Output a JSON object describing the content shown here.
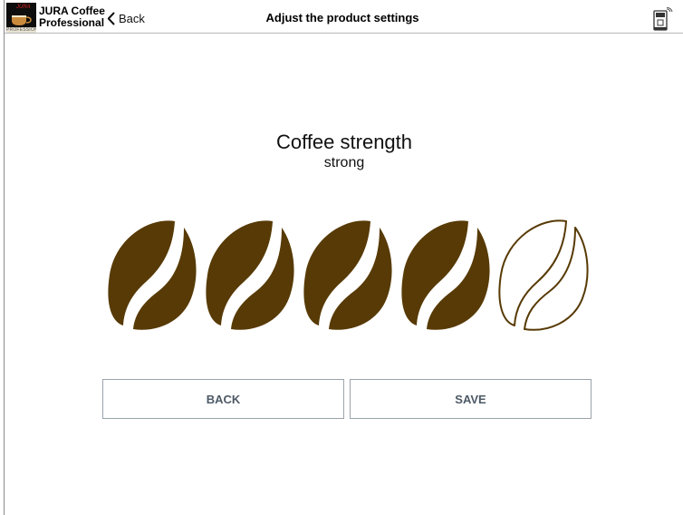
{
  "header": {
    "app_name_line1": "JURA Coffee",
    "app_name_line2": "Professional",
    "app_icon_brand": "JURA",
    "app_icon_strip": "PROFESSIONAL",
    "back_label": "Back",
    "title": "Adjust the product settings",
    "machine_icon": "coffee-machine-icon"
  },
  "setting": {
    "title": "Coffee strength",
    "value_label": "strong",
    "level": 4,
    "max_level": 5,
    "icon": "coffee-bean-icon"
  },
  "buttons": {
    "back_label": "BACK",
    "save_label": "SAVE"
  },
  "colors": {
    "bean_fill": "#573a05",
    "bean_outline": "#573a05",
    "button_text": "#4d5a66",
    "button_border": "#9aa3ab"
  }
}
